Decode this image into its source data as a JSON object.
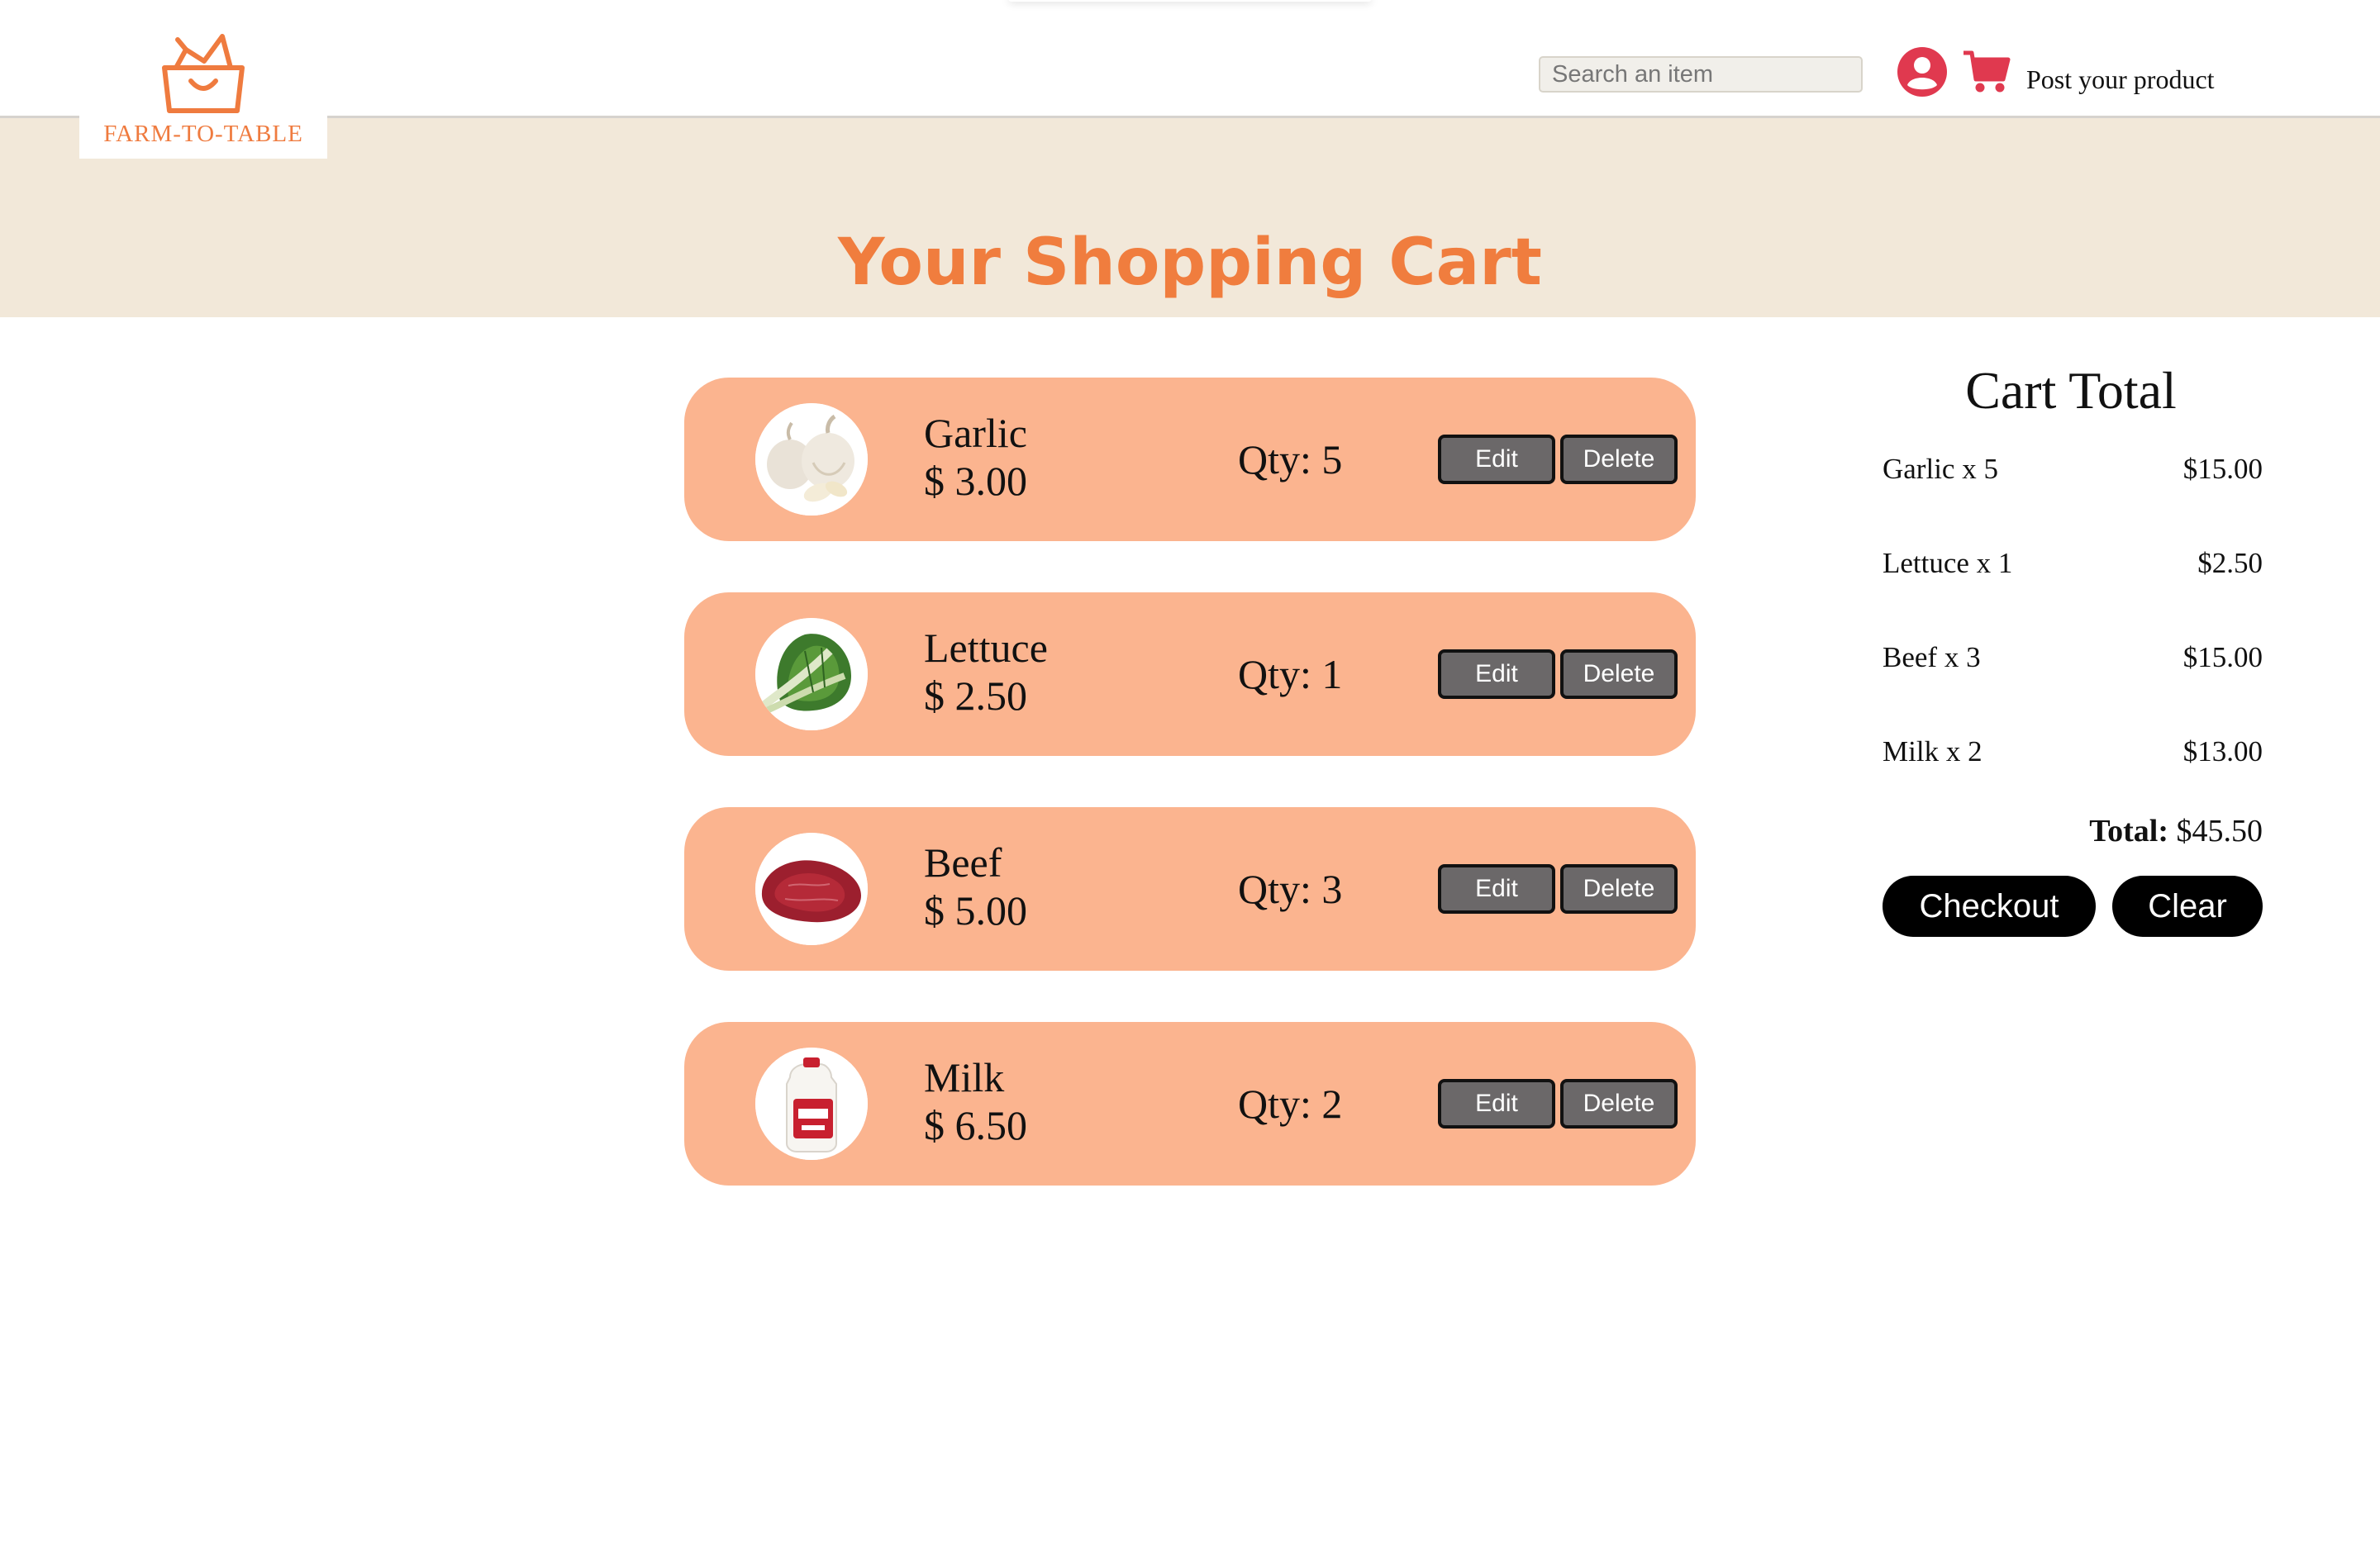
{
  "header": {
    "logo_text": "FARM-TO-TABLE",
    "search_placeholder": "Search an item",
    "post_link": "Post your product",
    "brand_color": "#ef7b3f",
    "icon_color": "#e0394f"
  },
  "hero": {
    "title": "Your Shopping Cart",
    "background": "#f2e8d9"
  },
  "items": [
    {
      "name": "Garlic",
      "price": "$ 3.00",
      "qty": "Qty: 5",
      "edit": "Edit",
      "delete": "Delete",
      "image": "garlic"
    },
    {
      "name": "Lettuce",
      "price": "$ 2.50",
      "qty": "Qty: 1",
      "edit": "Edit",
      "delete": "Delete",
      "image": "lettuce"
    },
    {
      "name": "Beef",
      "price": "$ 5.00",
      "qty": "Qty: 3",
      "edit": "Edit",
      "delete": "Delete",
      "image": "beef"
    },
    {
      "name": "Milk",
      "price": "$ 6.50",
      "qty": "Qty: 2",
      "edit": "Edit",
      "delete": "Delete",
      "image": "milk"
    }
  ],
  "summary": {
    "title": "Cart Total",
    "rows": [
      {
        "label": "Garlic x 5",
        "amount": "$15.00"
      },
      {
        "label": "Lettuce x 1",
        "amount": "$2.50"
      },
      {
        "label": "Beef x 3",
        "amount": "$15.00"
      },
      {
        "label": "Milk x 2",
        "amount": "$13.00"
      }
    ],
    "total_label": "Total:",
    "total_value": "$45.50",
    "checkout": "Checkout",
    "clear": "Clear"
  },
  "colors": {
    "card": "#fbb48f",
    "button": "#6b6869"
  }
}
